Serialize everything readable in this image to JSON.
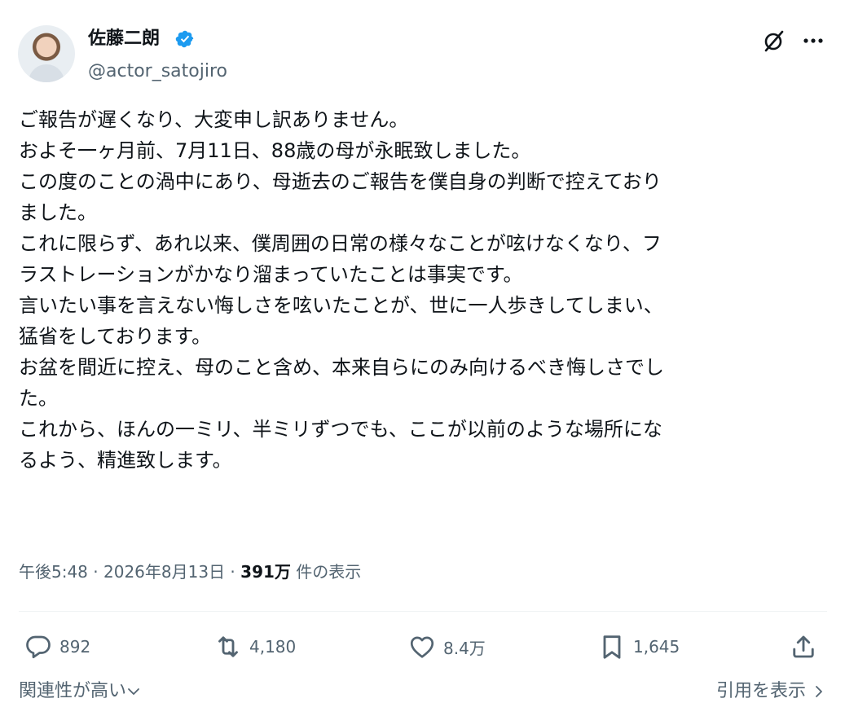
{
  "author": {
    "name": "佐藤二朗",
    "handle": "@actor_satojiro"
  },
  "tweet": {
    "lines": [
      "ご報告が遅くなり、大変申し訳ありません。",
      "およそ一ヶ月前、7月11日、88歳の母が永眠致しました。",
      "この度のことの渦中にあり、母逝去のご報告を僕自身の判断で控えており",
      "ました。",
      "これに限らず、あれ以来、僕周囲の日常の様々なことが呟けなくなり、フ",
      "ラストレーションがかなり溜まっていたことは事実です。",
      "言いたい事を言えない悔しさを呟いたことが、世に一人歩きしてしまい、",
      "猛省をしております。",
      "お盆を間近に控え、母のこと含め、本来自らにのみ向けるべき悔しさでし",
      "た。",
      "これから、ほんの一ミリ、半ミリずつでも、ここが以前のような場所にな",
      "るよう、精進致します。"
    ]
  },
  "meta": {
    "time": "午後5:48",
    "sep1": " · ",
    "date": "2026年8月13日",
    "sep2": " · ",
    "views": "391万",
    "views_label": " 件の表示"
  },
  "actions": {
    "replies": "892",
    "reposts": "4,180",
    "likes": "8.4万",
    "bookmarks": "1,645"
  },
  "footer": {
    "related": "関連性が高い",
    "quotes": "引用を表示"
  },
  "colors": {
    "verified": "#1d9bf0",
    "secondary_text": "#536471",
    "primary_text": "#0f1419"
  },
  "icons": [
    "verified-badge-icon",
    "grok-icon",
    "more-icon",
    "reply-icon",
    "repost-icon",
    "like-icon",
    "bookmark-icon",
    "share-icon",
    "chevron-down-icon",
    "chevron-right-icon"
  ]
}
